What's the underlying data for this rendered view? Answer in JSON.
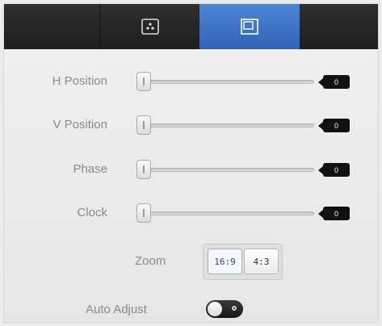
{
  "tabs": [
    {
      "name": "picture",
      "icon": "picture-settings-icon",
      "selected": false
    },
    {
      "name": "geometry",
      "icon": "geometry-frame-icon",
      "selected": true
    }
  ],
  "sliders": [
    {
      "label": "H Position",
      "value": "0"
    },
    {
      "label": "V Position",
      "value": "0"
    },
    {
      "label": "Phase",
      "value": "0"
    },
    {
      "label": "Clock",
      "value": "0"
    }
  ],
  "zoom": {
    "label": "Zoom",
    "options": [
      "16:9",
      "4:3"
    ],
    "selected": "16:9"
  },
  "auto_adjust": {
    "label": "Auto Adjust",
    "on": false
  },
  "colors": {
    "accent": "#3f74c8",
    "tabbar": "#262626",
    "value_badge": "#111111"
  }
}
